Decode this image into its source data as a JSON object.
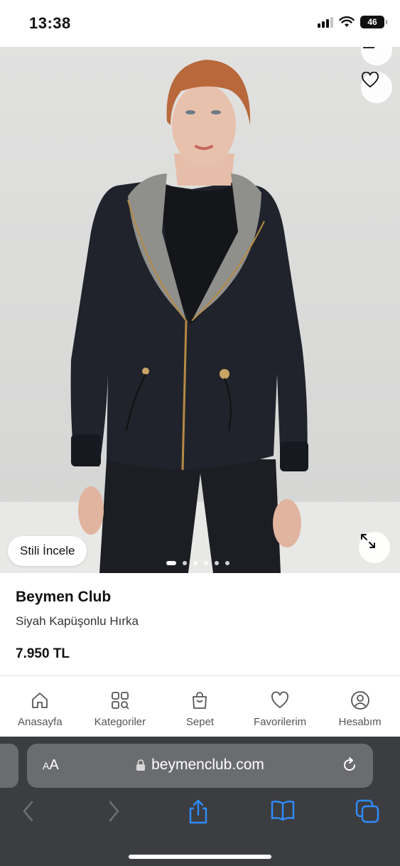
{
  "status_bar": {
    "time": "13:38",
    "battery": "46"
  },
  "hero": {
    "style_button_label": "Stili İncele",
    "dot_count": 6,
    "active_dot": 1
  },
  "product": {
    "brand": "Beymen Club",
    "name": "Siyah Kapüşonlu Hırka",
    "price": "7.950 TL"
  },
  "tabbar": {
    "items": [
      {
        "label": "Anasayfa",
        "icon": "home-icon"
      },
      {
        "label": "Kategoriler",
        "icon": "categories-icon"
      },
      {
        "label": "Sepet",
        "icon": "cart-icon"
      },
      {
        "label": "Favorilerim",
        "icon": "heart-icon"
      },
      {
        "label": "Hesabım",
        "icon": "account-icon"
      }
    ]
  },
  "safari": {
    "aa_small": "A",
    "aa_large": "A",
    "url": "beymenclub.com",
    "accent": "#2f8cff"
  }
}
